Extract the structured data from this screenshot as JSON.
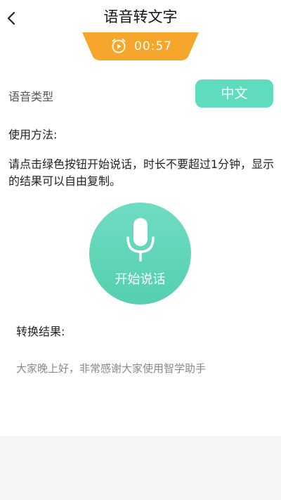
{
  "header": {
    "title": "语音转文字",
    "back_icon": "chevron-left-icon"
  },
  "timer": {
    "icon": "alarm-clock-play-icon",
    "time": "00:57",
    "color": "#f7a62c"
  },
  "voice_type": {
    "label": "语音类型",
    "selected_language": "中文"
  },
  "usage": {
    "heading": "使用方法:",
    "instructions": "请点击绿色按钮开始说话，时长不要超过1分钟，显示的结果可以自由复制。"
  },
  "mic": {
    "icon": "microphone-icon",
    "label": "开始说话",
    "color": "#5fd6b8"
  },
  "result": {
    "heading": "转换结果:",
    "text": "大家晚上好，非常感谢大家使用智学助手"
  },
  "colors": {
    "accent_green": "#5fdbbd",
    "timer_orange": "#f7a62c"
  }
}
